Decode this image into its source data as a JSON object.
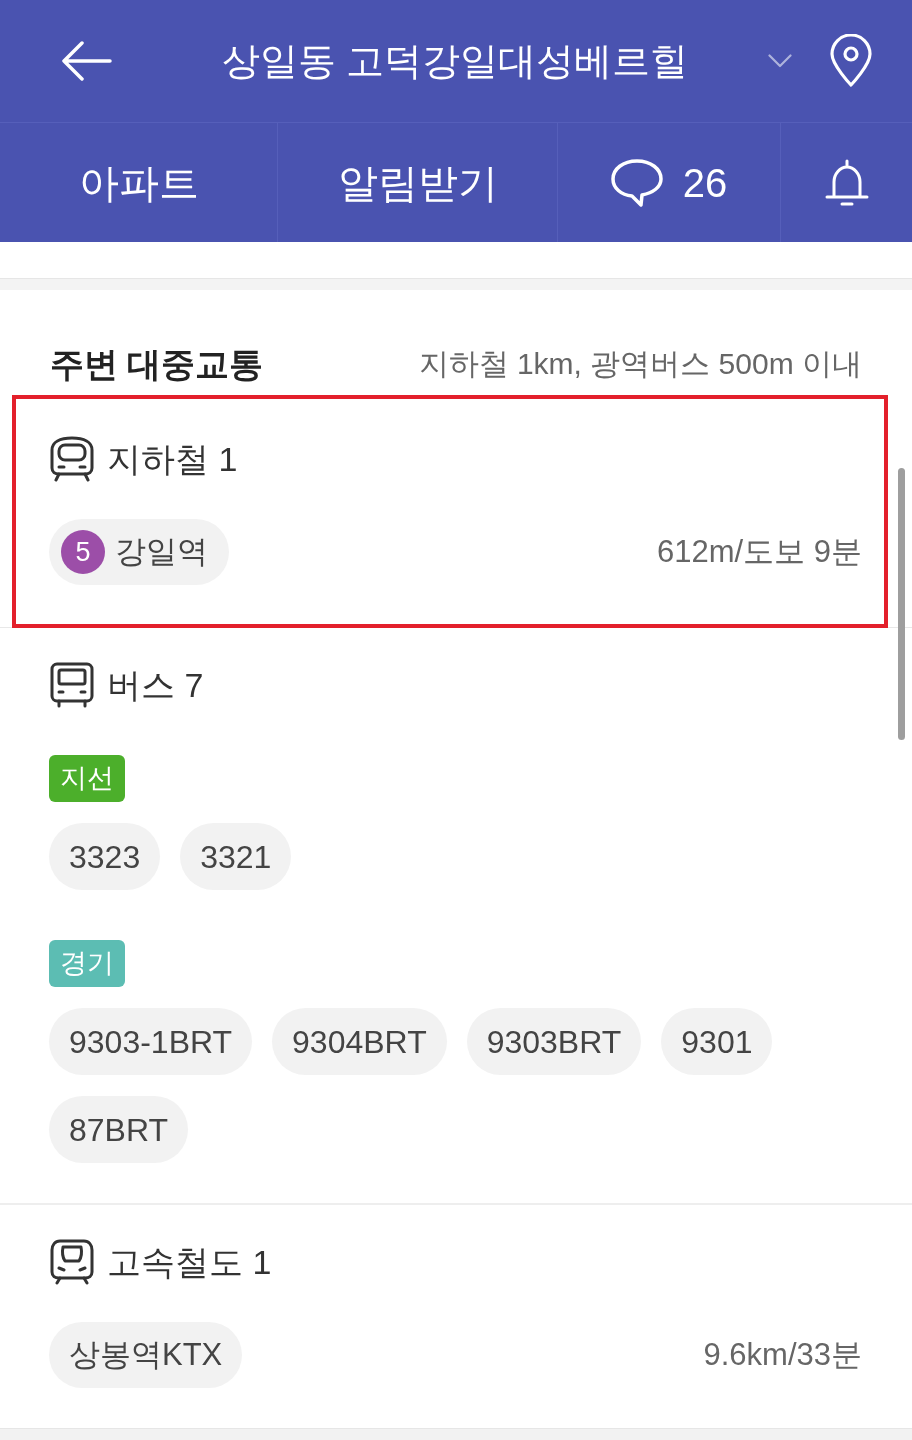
{
  "header": {
    "title": "상일동 고덕강일대성베르힐"
  },
  "toolbar": [
    {
      "kind": "text",
      "label": "아파트"
    },
    {
      "kind": "text",
      "label": "알림받기"
    },
    {
      "kind": "comments",
      "label": "26"
    },
    {
      "kind": "bell"
    }
  ],
  "section": {
    "title": "주변 대중교통",
    "note": "지하철 1km, 광역버스 500m 이내"
  },
  "groups": [
    {
      "kind": "subway",
      "title": "지하철 1",
      "highlighted": true,
      "stations": [
        {
          "line": "5",
          "color": "#9c4ea8",
          "name": "강일역",
          "distance": "612m/도보 9분"
        }
      ]
    },
    {
      "kind": "bus",
      "title": "버스 7",
      "highlighted": false,
      "categories": [
        {
          "tag": "지선",
          "color": "#4caf2b",
          "routes": [
            "3323",
            "3321"
          ]
        },
        {
          "tag": "경기",
          "color": "#5cbdb3",
          "routes": [
            "9303-1BRT",
            "9304BRT",
            "9303BRT",
            "9301",
            "87BRT"
          ]
        }
      ]
    },
    {
      "kind": "rail",
      "title": "고속철도 1",
      "highlighted": false,
      "stations": [
        {
          "name": "상봉역KTX",
          "distance": "9.6km/33분"
        }
      ]
    }
  ]
}
